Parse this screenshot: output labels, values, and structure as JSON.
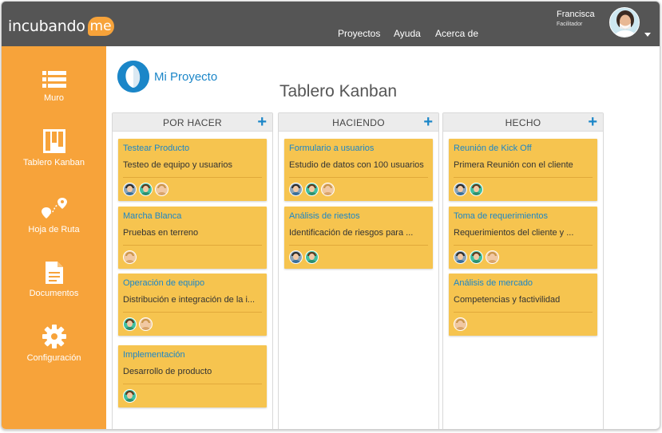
{
  "brand": {
    "logo_text": "incubando",
    "logo_badge": "me",
    "accent": "#f7a33a",
    "link_color": "#1b86c8"
  },
  "topnav": {
    "items": [
      "Proyectos",
      "Ayuda",
      "Acerca de"
    ]
  },
  "user": {
    "name": "Francisca",
    "role": "Facilitador"
  },
  "sidebar": {
    "items": [
      {
        "label": "Muro",
        "icon": "list-icon"
      },
      {
        "label": "Tablero Kanban",
        "icon": "kanban-icon"
      },
      {
        "label": "Hoja de Ruta",
        "icon": "route-icon"
      },
      {
        "label": "Documentos",
        "icon": "document-icon"
      },
      {
        "label": "Configuración",
        "icon": "gear-icon"
      }
    ]
  },
  "project": {
    "name": "Mi Proyecto"
  },
  "board": {
    "title": "Tablero Kanban",
    "add_symbol": "+",
    "columns": [
      {
        "title": "POR HACER",
        "cards": [
          {
            "title": "Testear Producto",
            "desc": "Testeo de equipo y usuarios",
            "avatars": [
              "a",
              "b",
              "c"
            ]
          },
          {
            "title": "Marcha Blanca",
            "desc": "Pruebas en terreno",
            "avatars": [
              "c"
            ]
          },
          {
            "title": "Operación de equipo",
            "desc": "Distribución e integración de la i...",
            "avatars": [
              "b",
              "c"
            ]
          },
          {
            "title": "Implementación",
            "desc": "Desarrollo de producto",
            "avatars": [
              "b"
            ]
          }
        ]
      },
      {
        "title": "HACIENDO",
        "cards": [
          {
            "title": "Formulario a usuarios",
            "desc": "Estudio de datos con 100 usuarios",
            "avatars": [
              "a",
              "b",
              "c"
            ]
          },
          {
            "title": "Análisis de riestos",
            "desc": "Identificación de riesgos para ...",
            "avatars": [
              "a",
              "b"
            ]
          }
        ]
      },
      {
        "title": "HECHO",
        "cards": [
          {
            "title": "Reunión de Kick Off",
            "desc": "Primera Reunión con el cliente",
            "avatars": [
              "a",
              "b"
            ]
          },
          {
            "title": "Toma de requerimientos",
            "desc": "Requerimientos del cliente y ...",
            "avatars": [
              "a",
              "b",
              "c"
            ]
          },
          {
            "title": "Análisis de mercado",
            "desc": "Competencias y factivilidad",
            "avatars": [
              "c"
            ]
          }
        ]
      }
    ]
  }
}
